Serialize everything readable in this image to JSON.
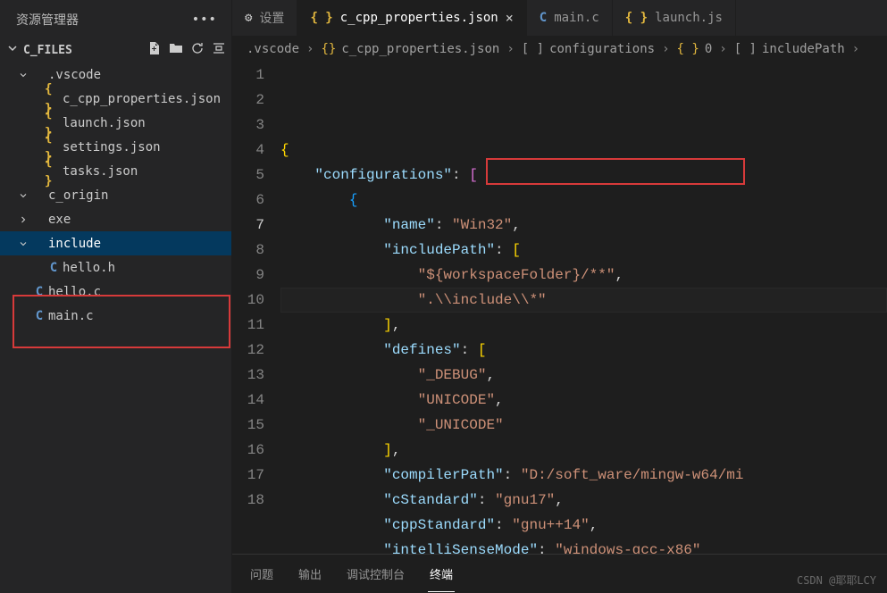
{
  "sidebar": {
    "title": "资源管理器",
    "project": "C_FILES",
    "items": [
      {
        "label": ".vscode",
        "type": "folder",
        "expanded": true,
        "indent": 1
      },
      {
        "label": "c_cpp_properties.json",
        "type": "json",
        "indent": 2
      },
      {
        "label": "launch.json",
        "type": "json",
        "indent": 2
      },
      {
        "label": "settings.json",
        "type": "json",
        "indent": 2
      },
      {
        "label": "tasks.json",
        "type": "json",
        "indent": 2
      },
      {
        "label": "c_origin",
        "type": "folder",
        "expanded": true,
        "indent": 1
      },
      {
        "label": "exe",
        "type": "folder",
        "expanded": false,
        "indent": 1
      },
      {
        "label": "include",
        "type": "folder",
        "expanded": true,
        "indent": 1,
        "selected": true
      },
      {
        "label": "hello.h",
        "type": "c",
        "indent": 2
      },
      {
        "label": "hello.c",
        "type": "c",
        "indent": 1
      },
      {
        "label": "main.c",
        "type": "c",
        "indent": 1
      }
    ]
  },
  "tabs": [
    {
      "label": "设置",
      "icon": "gear",
      "active": false
    },
    {
      "label": "c_cpp_properties.json",
      "icon": "json",
      "active": true
    },
    {
      "label": "main.c",
      "icon": "c",
      "active": false
    },
    {
      "label": "launch.js",
      "icon": "json",
      "active": false
    }
  ],
  "breadcrumb": {
    "parts": [
      {
        "text": ".vscode",
        "icon": ""
      },
      {
        "text": "c_cpp_properties.json",
        "icon": "{}"
      },
      {
        "text": "configurations",
        "icon": "[ ]"
      },
      {
        "text": "0",
        "icon": "{ }"
      },
      {
        "text": "includePath",
        "icon": "[ ]"
      }
    ]
  },
  "editor": {
    "current_line": 7,
    "lines": [
      {
        "n": 1,
        "html": "<span class='tok-brace'>{</span>"
      },
      {
        "n": 2,
        "html": "    <span class='tok-key'>\"configurations\"</span><span class='tok-colon'>:</span> <span class='tok-brace2'>[</span>"
      },
      {
        "n": 3,
        "html": "        <span class='tok-brace3'>{</span>"
      },
      {
        "n": 4,
        "html": "            <span class='tok-key'>\"name\"</span><span class='tok-colon'>:</span> <span class='tok-str'>\"Win32\"</span><span class='tok-delim'>,</span>"
      },
      {
        "n": 5,
        "html": "            <span class='tok-key'>\"includePath\"</span><span class='tok-colon'>:</span> <span class='tok-brace'>[</span>"
      },
      {
        "n": 6,
        "html": "                <span class='tok-str'>\"${workspaceFolder}/**\"</span><span class='tok-delim'>,</span>"
      },
      {
        "n": 7,
        "html": "                <span class='tok-str'>\".\\\\include\\\\*\"</span>"
      },
      {
        "n": 8,
        "html": "            <span class='tok-brace'>]</span><span class='tok-delim'>,</span>"
      },
      {
        "n": 9,
        "html": "            <span class='tok-key'>\"defines\"</span><span class='tok-colon'>:</span> <span class='tok-brace'>[</span>"
      },
      {
        "n": 10,
        "html": "                <span class='tok-str'>\"_DEBUG\"</span><span class='tok-delim'>,</span>"
      },
      {
        "n": 11,
        "html": "                <span class='tok-str'>\"UNICODE\"</span><span class='tok-delim'>,</span>"
      },
      {
        "n": 12,
        "html": "                <span class='tok-str'>\"_UNICODE\"</span>"
      },
      {
        "n": 13,
        "html": "            <span class='tok-brace'>]</span><span class='tok-delim'>,</span>"
      },
      {
        "n": 14,
        "html": "            <span class='tok-key'>\"compilerPath\"</span><span class='tok-colon'>:</span> <span class='tok-str'>\"D:/soft_ware/mingw-w64/mi</span>"
      },
      {
        "n": 15,
        "html": "            <span class='tok-key'>\"cStandard\"</span><span class='tok-colon'>:</span> <span class='tok-str'>\"gnu17\"</span><span class='tok-delim'>,</span>"
      },
      {
        "n": 16,
        "html": "            <span class='tok-key'>\"cppStandard\"</span><span class='tok-colon'>:</span> <span class='tok-str'>\"gnu++14\"</span><span class='tok-delim'>,</span>"
      },
      {
        "n": 17,
        "html": "            <span class='tok-key'>\"intelliSenseMode\"</span><span class='tok-colon'>:</span> <span class='tok-str'>\"windows-gcc-x86\"</span>"
      },
      {
        "n": 18,
        "html": "        <span class='tok-brace3'>}</span>"
      }
    ]
  },
  "bottomPanel": {
    "tabs": [
      "问题",
      "输出",
      "调试控制台",
      "终端"
    ],
    "active": "终端"
  },
  "watermark": "CSDN @耶耶LCY"
}
